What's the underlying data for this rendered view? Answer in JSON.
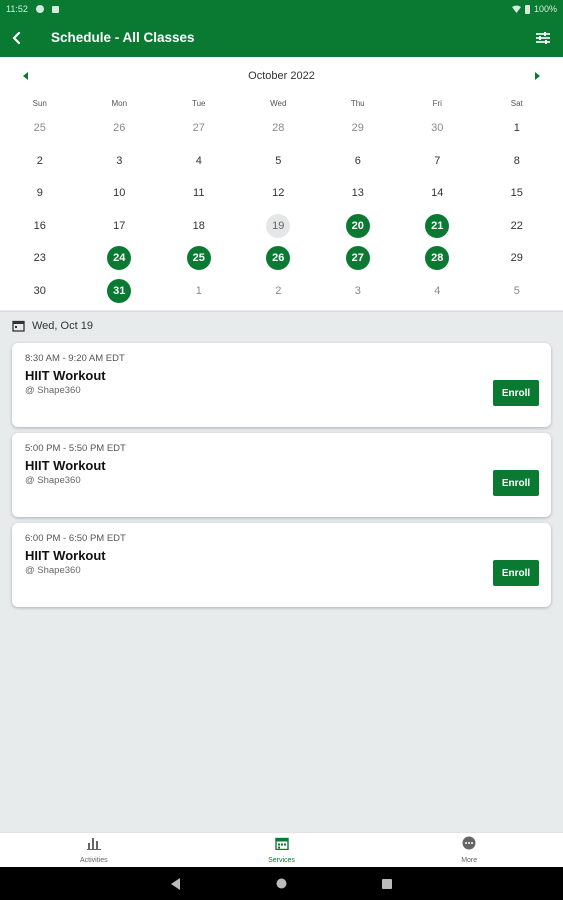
{
  "status_bar": {
    "time": "11:52",
    "battery": "100%"
  },
  "header": {
    "title": "Schedule - All Classes",
    "back_icon": "chevron-left-icon",
    "filter_icon": "sliders-icon"
  },
  "calendar": {
    "month": "October 2022",
    "weekdays": [
      "Sun",
      "Mon",
      "Tue",
      "Wed",
      "Thu",
      "Fri",
      "Sat"
    ],
    "weeks": [
      [
        {
          "d": "25",
          "s": "other"
        },
        {
          "d": "26",
          "s": "other"
        },
        {
          "d": "27",
          "s": "other"
        },
        {
          "d": "28",
          "s": "other"
        },
        {
          "d": "29",
          "s": "other"
        },
        {
          "d": "30",
          "s": "other"
        },
        {
          "d": "1",
          "s": ""
        }
      ],
      [
        {
          "d": "2",
          "s": ""
        },
        {
          "d": "3",
          "s": ""
        },
        {
          "d": "4",
          "s": ""
        },
        {
          "d": "5",
          "s": ""
        },
        {
          "d": "6",
          "s": ""
        },
        {
          "d": "7",
          "s": ""
        },
        {
          "d": "8",
          "s": ""
        }
      ],
      [
        {
          "d": "9",
          "s": ""
        },
        {
          "d": "10",
          "s": ""
        },
        {
          "d": "11",
          "s": ""
        },
        {
          "d": "12",
          "s": ""
        },
        {
          "d": "13",
          "s": ""
        },
        {
          "d": "14",
          "s": ""
        },
        {
          "d": "15",
          "s": ""
        }
      ],
      [
        {
          "d": "16",
          "s": ""
        },
        {
          "d": "17",
          "s": ""
        },
        {
          "d": "18",
          "s": ""
        },
        {
          "d": "19",
          "s": "selected"
        },
        {
          "d": "20",
          "s": "available"
        },
        {
          "d": "21",
          "s": "available"
        },
        {
          "d": "22",
          "s": ""
        }
      ],
      [
        {
          "d": "23",
          "s": ""
        },
        {
          "d": "24",
          "s": "available"
        },
        {
          "d": "25",
          "s": "available"
        },
        {
          "d": "26",
          "s": "available"
        },
        {
          "d": "27",
          "s": "available"
        },
        {
          "d": "28",
          "s": "available"
        },
        {
          "d": "29",
          "s": ""
        }
      ],
      [
        {
          "d": "30",
          "s": ""
        },
        {
          "d": "31",
          "s": "available"
        },
        {
          "d": "1",
          "s": "other"
        },
        {
          "d": "2",
          "s": "other"
        },
        {
          "d": "3",
          "s": "other"
        },
        {
          "d": "4",
          "s": "other"
        },
        {
          "d": "5",
          "s": "other"
        }
      ]
    ]
  },
  "selected_date": {
    "label": "Wed, Oct 19"
  },
  "classes": [
    {
      "time": "8:30 AM - 9:20 AM EDT",
      "name": "HIIT Workout",
      "location": "@ Shape360",
      "action": "Enroll"
    },
    {
      "time": "5:00 PM - 5:50 PM EDT",
      "name": "HIIT Workout",
      "location": "@ Shape360",
      "action": "Enroll"
    },
    {
      "time": "6:00 PM - 6:50 PM EDT",
      "name": "HIIT Workout",
      "location": "@ Shape360",
      "action": "Enroll"
    }
  ],
  "bottom_nav": [
    {
      "label": "Activities",
      "icon": "bar-chart-icon",
      "active": false
    },
    {
      "label": "Services",
      "icon": "calendar-icon",
      "active": true
    },
    {
      "label": "More",
      "icon": "more-icon",
      "active": false
    }
  ],
  "colors": {
    "brand": "#0a7a33",
    "background": "#e8ebec",
    "selected_day": "#e4e6e7"
  }
}
